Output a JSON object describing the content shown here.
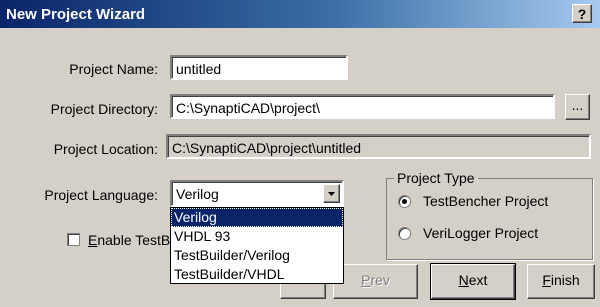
{
  "window": {
    "title": "New Project Wizard",
    "help_label": "?"
  },
  "form": {
    "project_name_label": "Project Name:",
    "project_name_value": "untitled",
    "project_directory_label": "Project Directory:",
    "project_directory_value": "C:\\SynaptiCAD\\project\\",
    "browse_label": "...",
    "project_location_label": "Project Location:",
    "project_location_value": "C:\\SynaptiCAD\\project\\untitled",
    "project_language_label": "Project Language:",
    "project_language_value": "Verilog",
    "enable_testbuilder_label_prefix": "E",
    "enable_testbuilder_label_rest": "nable TestBuild"
  },
  "language_options": [
    "Verilog",
    "VHDL 93",
    "TestBuilder/Verilog",
    "TestBuilder/VHDL"
  ],
  "project_type": {
    "title": "Project Type",
    "options": [
      "TestBencher Project",
      "VeriLogger Project"
    ],
    "selected": "TestBencher Project"
  },
  "buttons": {
    "prev_prefix": "P",
    "prev_rest": "rev",
    "next_prefix": "N",
    "next_rest": "ext",
    "finish_prefix": "F",
    "finish_rest": "inish"
  },
  "colors": {
    "title_bar": "#0a246a",
    "face": "#d4d0c8",
    "selection": "#0a246a"
  }
}
